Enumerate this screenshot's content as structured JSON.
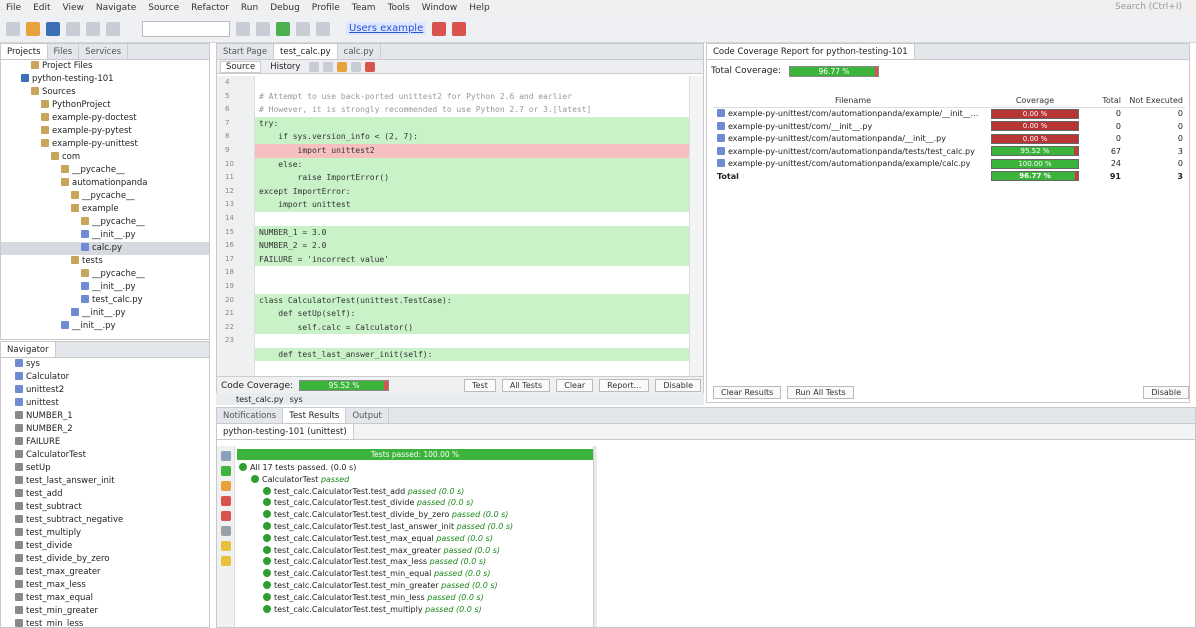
{
  "menu": [
    "File",
    "Edit",
    "View",
    "Navigate",
    "Source",
    "Refactor",
    "Run",
    "Debug",
    "Profile",
    "Team",
    "Tools",
    "Window",
    "Help"
  ],
  "search_placeholder": "Search (Ctrl+I)",
  "profile_badge": "Users example",
  "projects": {
    "tabs": [
      "Projects",
      "Files",
      "Services"
    ],
    "rows": [
      {
        "t": "Project Files",
        "d": 3,
        "i": "f"
      },
      {
        "t": "python-testing-101",
        "d": 2,
        "i": "p"
      },
      {
        "t": "Sources",
        "d": 3,
        "i": "f"
      },
      {
        "t": "PythonProject",
        "d": 4,
        "i": "f"
      },
      {
        "t": "example-py-doctest",
        "d": 4,
        "i": "f"
      },
      {
        "t": "example-py-pytest",
        "d": 4,
        "i": "f"
      },
      {
        "t": "example-py-unittest",
        "d": 4,
        "i": "f"
      },
      {
        "t": "com",
        "d": 5,
        "i": "f"
      },
      {
        "t": "__pycache__",
        "d": 6,
        "i": "f"
      },
      {
        "t": "automationpanda",
        "d": 6,
        "i": "f"
      },
      {
        "t": "__pycache__",
        "d": 7,
        "i": "f"
      },
      {
        "t": "example",
        "d": 7,
        "i": "f"
      },
      {
        "t": "__pycache__",
        "d": 8,
        "i": "f"
      },
      {
        "t": "__init__.py",
        "d": 8,
        "i": "v"
      },
      {
        "t": "calc.py",
        "d": 8,
        "i": "v",
        "sel": true
      },
      {
        "t": "tests",
        "d": 7,
        "i": "f"
      },
      {
        "t": "__pycache__",
        "d": 8,
        "i": "f"
      },
      {
        "t": "__init__.py",
        "d": 8,
        "i": "v"
      },
      {
        "t": "test_calc.py",
        "d": 8,
        "i": "v"
      },
      {
        "t": "__init__.py",
        "d": 7,
        "i": "v"
      },
      {
        "t": "__init__.py",
        "d": 6,
        "i": "v"
      }
    ]
  },
  "navigator": {
    "tab": "Navigator",
    "rows": [
      "sys",
      "Calculator",
      "unittest2",
      "unittest",
      "NUMBER_1",
      "NUMBER_2",
      "FAILURE",
      "CalculatorTest",
      "setUp",
      "test_last_answer_init",
      "test_add",
      "test_subtract",
      "test_subtract_negative",
      "test_multiply",
      "test_divide",
      "test_divide_by_zero",
      "test_max_greater",
      "test_max_less",
      "test_max_equal",
      "test_min_greater",
      "test_min_less"
    ]
  },
  "editor": {
    "tabs": [
      "Start Page",
      "test_calc.py",
      "calc.py"
    ],
    "subtabs": [
      "Source",
      "History"
    ],
    "line_numbers": [
      "4",
      "5",
      "6",
      "7",
      "8",
      "9",
      "10",
      "11",
      "12",
      "13",
      "14",
      "15",
      "16",
      "17",
      "18",
      "19",
      "20",
      "21",
      "22",
      "23"
    ],
    "lines": [
      {
        "t": "",
        "s": ""
      },
      {
        "t": "# Attempt to use back-ported unittest2 for Python 2.6 and earlier",
        "s": "c"
      },
      {
        "t": "# However, it is strongly recommended to use Python 2.7 or 3.[latest]",
        "s": "c"
      },
      {
        "t": "try:",
        "s": "g"
      },
      {
        "t": "    if sys.version_info < (2, 7):",
        "s": "g"
      },
      {
        "t": "        import unittest2",
        "s": "r"
      },
      {
        "t": "    else:",
        "s": "g"
      },
      {
        "t": "        raise ImportError()",
        "s": "g"
      },
      {
        "t": "except ImportError:",
        "s": "g"
      },
      {
        "t": "    import unittest",
        "s": "g"
      },
      {
        "t": "",
        "s": ""
      },
      {
        "t": "NUMBER_1 = 3.0",
        "s": "g"
      },
      {
        "t": "NUMBER_2 = 2.0",
        "s": "g"
      },
      {
        "t": "FAILURE = 'incorrect value'",
        "s": "g"
      },
      {
        "t": "",
        "s": ""
      },
      {
        "t": "",
        "s": ""
      },
      {
        "t": "class CalculatorTest(unittest.TestCase):",
        "s": "g"
      },
      {
        "t": "    def setUp(self):",
        "s": "g"
      },
      {
        "t": "        self.calc = Calculator()",
        "s": "g"
      },
      {
        "t": "",
        "s": ""
      },
      {
        "t": "    def test_last_answer_init(self):",
        "s": "g"
      }
    ],
    "coverage_label": "Code Coverage:",
    "coverage_value": "95.52 %",
    "coverage_fraction": 0.9552,
    "buttons": [
      "Test",
      "All Tests",
      "Clear",
      "Report...",
      "Disable"
    ],
    "breadcrumbs": [
      "test_calc.py",
      "sys"
    ]
  },
  "coverage": {
    "tab": "Code Coverage Report for python-testing-101",
    "total_label": "Total Coverage:",
    "total_value": "96.77 %",
    "total_fraction": 0.9677,
    "headers": [
      "Filename",
      "Coverage",
      "Total",
      "Not Executed"
    ],
    "rows": [
      {
        "file": "example-py-unittest/com/automationpanda/example/__init__...",
        "cov": "0.00 %",
        "f": 0.0,
        "total": "0",
        "ne": "0"
      },
      {
        "file": "example-py-unittest/com/__init__.py",
        "cov": "0.00 %",
        "f": 0.0,
        "total": "0",
        "ne": "0"
      },
      {
        "file": "example-py-unittest/com/automationpanda/__init__.py",
        "cov": "0.00 %",
        "f": 0.0,
        "total": "0",
        "ne": "0"
      },
      {
        "file": "example-py-unittest/com/automationpanda/tests/test_calc.py",
        "cov": "95.52 %",
        "f": 0.9552,
        "total": "67",
        "ne": "3"
      },
      {
        "file": "example-py-unittest/com/automationpanda/example/calc.py",
        "cov": "100.00 %",
        "f": 1.0,
        "total": "24",
        "ne": "0"
      },
      {
        "file": "Total",
        "cov": "96.77 %",
        "f": 0.9677,
        "total": "91",
        "ne": "3",
        "bold": true
      }
    ],
    "buttons": [
      "Clear Results",
      "Run All Tests"
    ],
    "done_button": "Disable"
  },
  "results": {
    "tabs": [
      "Notifications",
      "Test Results",
      "Output"
    ],
    "session_tab": "python-testing-101 (unittest)",
    "bar_label": "Tests passed: 100.00 %",
    "summary": "All 17 tests passed. (0.0 s)",
    "suite": "CalculatorTest",
    "suite_status": "passed",
    "tests": [
      "test_calc.CalculatorTest.test_add",
      "test_calc.CalculatorTest.test_divide",
      "test_calc.CalculatorTest.test_divide_by_zero",
      "test_calc.CalculatorTest.test_last_answer_init",
      "test_calc.CalculatorTest.test_max_equal",
      "test_calc.CalculatorTest.test_max_greater",
      "test_calc.CalculatorTest.test_max_less",
      "test_calc.CalculatorTest.test_min_equal",
      "test_calc.CalculatorTest.test_min_greater",
      "test_calc.CalculatorTest.test_min_less",
      "test_calc.CalculatorTest.test_multiply"
    ],
    "test_status": "passed (0.0 s)"
  }
}
